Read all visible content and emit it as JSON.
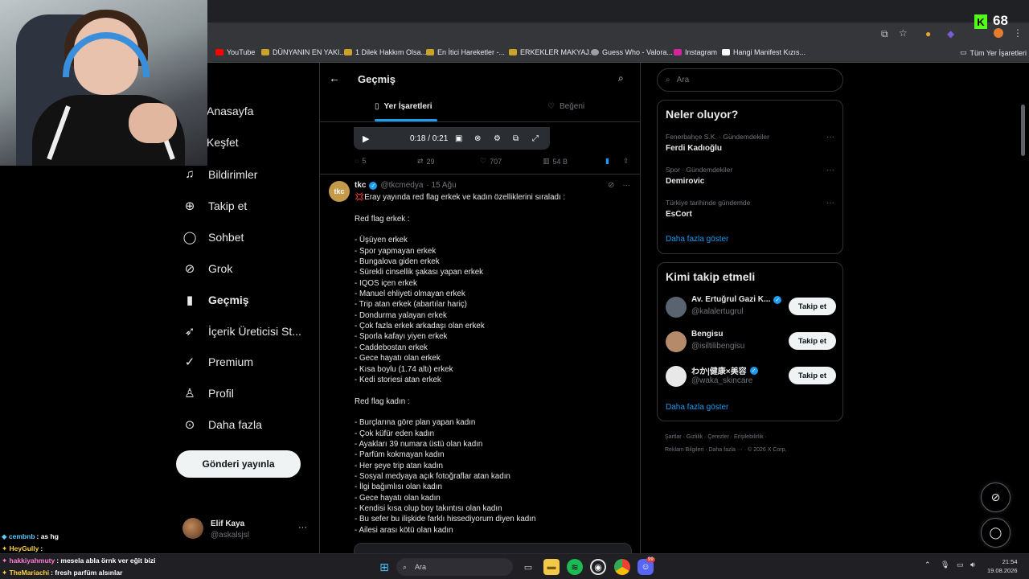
{
  "browser": {
    "bookmarks": [
      {
        "label": "YouTube",
        "color": "#ff0000"
      },
      {
        "label": "DÜNYANIN EN YAKI...",
        "color": "#c9a227"
      },
      {
        "label": "1 Dilek Hakkım Olsa...",
        "color": "#c9a227"
      },
      {
        "label": "En İtici Hareketler -...",
        "color": "#c9a227"
      },
      {
        "label": "ERKEKLER MAKYAJ...",
        "color": "#c9a227"
      },
      {
        "label": "Guess Who - Valora...",
        "color": "#9aa0a6"
      },
      {
        "label": "Instagram",
        "color": "#d6249f"
      },
      {
        "label": "Hangi Manifest Kızıs...",
        "color": "#ffffff"
      }
    ],
    "all_bookmarks_label": "Tüm Yer İşaretleri",
    "kick_viewers": "68"
  },
  "nav": {
    "items": [
      {
        "label": "Anasayfa",
        "icon": "home-icon",
        "glyph": "⌂"
      },
      {
        "label": "Keşfet",
        "icon": "explore-icon",
        "glyph": "⌕"
      },
      {
        "label": "Bildirimler",
        "icon": "bell-icon",
        "glyph": "🔔︎"
      },
      {
        "label": "Takip et",
        "icon": "follow-icon",
        "glyph": "👤︎"
      },
      {
        "label": "Sohbet",
        "icon": "chat-icon",
        "glyph": "💬︎"
      },
      {
        "label": "Grok",
        "icon": "grok-icon",
        "glyph": "⊘"
      },
      {
        "label": "Geçmiş",
        "icon": "bookmark-icon",
        "glyph": "🔖︎",
        "active": true
      },
      {
        "label": "İçerik Üreticisi St...",
        "icon": "rocket-icon",
        "glyph": "🚀︎"
      },
      {
        "label": "Premium",
        "icon": "premium-icon",
        "glyph": "✓"
      },
      {
        "label": "Profil",
        "icon": "profile-icon",
        "glyph": "👤︎"
      },
      {
        "label": "Daha fazla",
        "icon": "more-circle-icon",
        "glyph": "⋯"
      }
    ],
    "post_button": "Gönderi yayınla",
    "profile": {
      "name": "Elif Kaya",
      "handle": "@askalsjsl"
    }
  },
  "main": {
    "title": "Geçmiş",
    "tabs": [
      {
        "label": "Yer İşaretleri",
        "active": true
      },
      {
        "label": "Beğeni",
        "active": false
      }
    ],
    "video_time": "0:18 / 0:21",
    "prev_tweet_actions": {
      "replies": "5",
      "retweets": "29",
      "likes": "707",
      "views": "54 B"
    },
    "tweet": {
      "avatar_text": "tkc",
      "name": "tkc",
      "handle": "@tkcmedya",
      "date": "· 15 Ağu",
      "lines": [
        "💢Eray yayında red flag erkek ve kadın özelliklerini sıraladı :",
        "",
        "Red flag erkek :",
        "",
        "- Üşüyen erkek",
        "- Spor yapmayan erkek",
        "- Bungalova giden erkek",
        "- Sürekli cinsellik şakası yapan erkek",
        "- IQOS içen erkek",
        "- Manuel ehliyeti olmayan erkek",
        "- Trip atan erkek (abartılar hariç)",
        "- Dondurma yalayan erkek",
        "- Çok fazla erkek arkadaşı olan erkek",
        "- Sporla kafayı yiyen erkek",
        "- Caddebostan erkek",
        "- Gece hayatı olan erkek",
        "- Kısa boylu (1.74 altı) erkek",
        "- Kedi storiesi atan erkek",
        "",
        "Red flag kadın :",
        "",
        "- Burçlarına göre plan yapan kadın",
        "- Çok küfür eden kadın",
        "- Ayakları 39 numara üstü olan kadın",
        "- Parfüm kokmayan kadın",
        "- Her şeye trip atan kadın",
        "- Sosyal medyaya açık fotoğraflar atan kadın",
        "- İlgi bağımlısı olan kadın",
        "- Gece hayatı olan kadın",
        "- Kendisi kısa olup boy takıntısı olan kadın",
        "- Bu sefer bu ilişkide farklı hissediyorum diyen kadın",
        "- Ailesi arası kötü olan kadın"
      ]
    }
  },
  "right": {
    "search_placeholder": "Ara",
    "trends_title": "Neler oluyor?",
    "trends": [
      {
        "meta": "Fenerbahçe S.K. · Gündemdekiler",
        "name": "Ferdi Kadıoğlu"
      },
      {
        "meta": "Spor · Gündemdekiler",
        "name": "Demirovic"
      },
      {
        "meta": "Türkiye tarihinde gündemde",
        "name": "EsCort"
      }
    ],
    "show_more": "Daha fazla göster",
    "who_to_follow_title": "Kimi takip etmeli",
    "who_to_follow": [
      {
        "name": "Av. Ertuğrul Gazi K...",
        "handle": "@kalalertugrul",
        "verified": true,
        "avatar_color": "#5a6470"
      },
      {
        "name": "Bengisu",
        "handle": "@isiltilibengisu",
        "verified": false,
        "avatar_color": "#b58a6a"
      },
      {
        "name": "わか|健康×美容",
        "handle": "@waka_skincare",
        "verified": true,
        "avatar_color": "#e8e8e8"
      }
    ],
    "follow_label": "Takip et",
    "footer": [
      "Şartlar",
      "Gizlilik",
      "Çerezler",
      "Erişilebilirlik",
      "Reklam Bilgileri",
      "Daha fazla ···",
      "© 2026 X Corp."
    ]
  },
  "chat": [
    {
      "user": "cembnb",
      "color": "#5ec8ff",
      "text": ": as hg"
    },
    {
      "user": "HeyGully",
      "color": "#ffd23f",
      "text": ":"
    },
    {
      "user": "hakkiyahmuty",
      "color": "#ff7bd5",
      "text": ": mesela abla örnk ver eğit bizi"
    },
    {
      "user": "TheMariachi",
      "color": "#ffd23f",
      "text": ": fresh parfüm alsınlar"
    }
  ],
  "taskbar": {
    "search_placeholder": "Ara",
    "time": "21:54",
    "date": "19.08.2026",
    "discord_badge": "99"
  }
}
